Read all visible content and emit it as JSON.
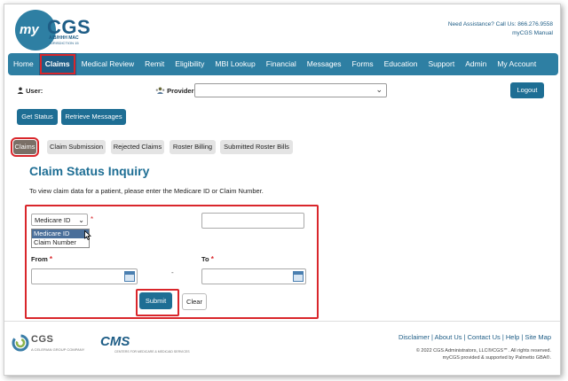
{
  "header": {
    "logo_my": "my",
    "logo_cgs": "CGS",
    "logo_sub": "A/B/HHH MAC",
    "logo_sub2": "JURISDICTION 15",
    "assist_line1": "Need Assistance? Call Us: 866.276.9558",
    "assist_line2": "myCGS Manual"
  },
  "nav": {
    "items": [
      {
        "label": "Home"
      },
      {
        "label": "Claims"
      },
      {
        "label": "Medical Review"
      },
      {
        "label": "Remit"
      },
      {
        "label": "Eligibility"
      },
      {
        "label": "MBI Lookup"
      },
      {
        "label": "Financial"
      },
      {
        "label": "Messages"
      },
      {
        "label": "Forms"
      },
      {
        "label": "Education"
      },
      {
        "label": "Support"
      },
      {
        "label": "Admin"
      },
      {
        "label": "My Account"
      }
    ],
    "active": "Claims"
  },
  "session": {
    "user_label": "User:",
    "provider_label": "Provider:",
    "provider_value": "",
    "logout": "Logout"
  },
  "actions": {
    "get_status": "Get Status",
    "retrieve_messages": "Retrieve Messages"
  },
  "subtabs": [
    {
      "label": "Claims"
    },
    {
      "label": "Claim Submission"
    },
    {
      "label": "Rejected Claims"
    },
    {
      "label": "Roster Billing"
    },
    {
      "label": "Submitted Roster Bills"
    }
  ],
  "page": {
    "title": "Claim Status Inquiry",
    "instruction": "To view claim data for a patient, please enter the Medicare ID or Claim Number."
  },
  "form": {
    "id_type_selected": "Medicare ID",
    "id_type_options": [
      "Medicare ID",
      "Claim Number"
    ],
    "required_mark": "*",
    "id_value": "",
    "from_label": "From",
    "to_label": "To",
    "from_value": "",
    "to_value": "",
    "dash": "-",
    "submit": "Submit",
    "clear": "Clear"
  },
  "footer": {
    "cgs_name": "CGS",
    "cgs_tag": "A CELERIAN GROUP COMPANY",
    "cms_name": "CMS",
    "cms_tag": "CENTERS FOR MEDICARE & MEDICAID SERVICES",
    "links": "Disclaimer | About Us | Contact Us | Help | Site Map",
    "copy1": "© 2022 CGS Administrators, LLC®/CGS℠. All rights reserved.",
    "copy2": "myCGS provided & supported by Palmetto GBA®."
  },
  "colors": {
    "brand": "#2e7fa3",
    "brand_dark": "#1e6e94",
    "highlight": "#d9262b"
  },
  "icons": [
    "user-icon",
    "provider-icon",
    "chevron-down-icon",
    "calendar-icon",
    "cursor-icon"
  ]
}
